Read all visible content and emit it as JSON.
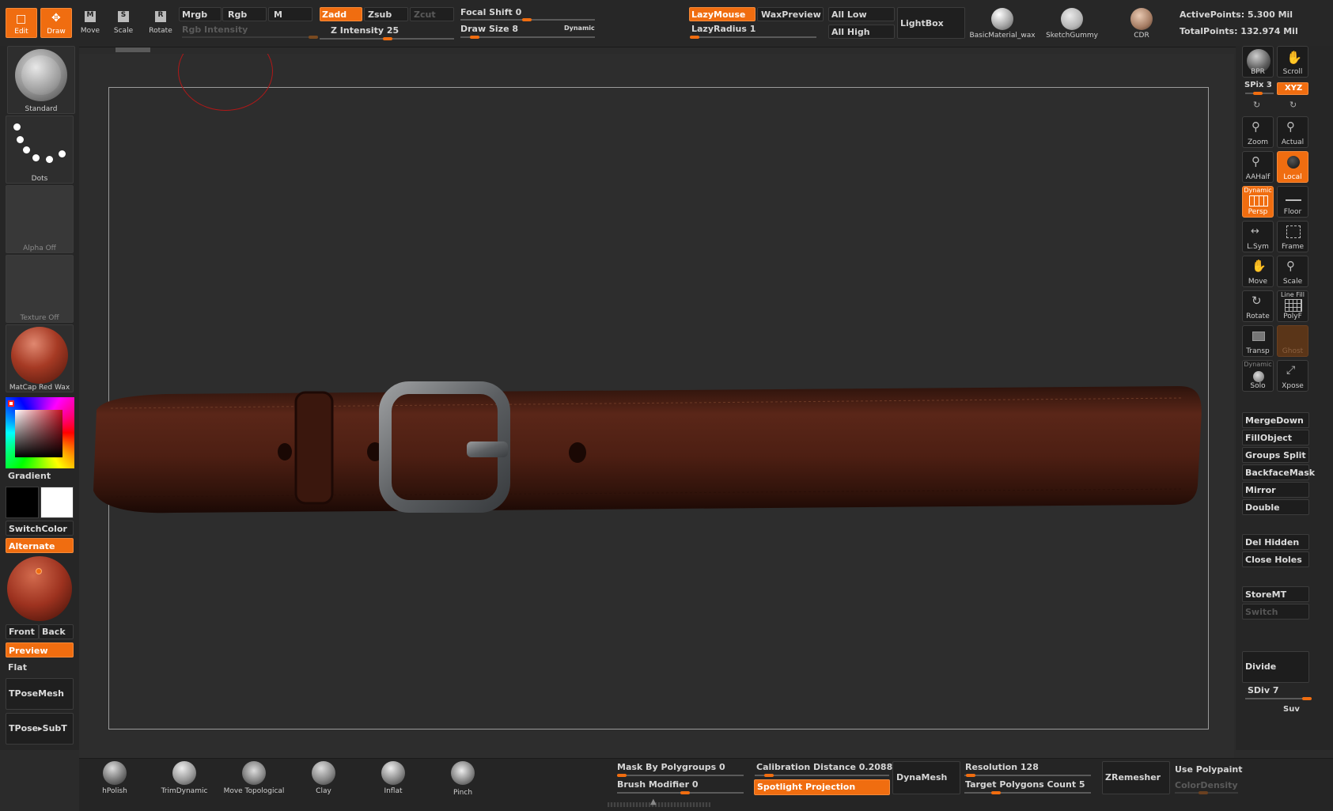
{
  "top": {
    "edit": "Edit",
    "draw": "Draw",
    "move": "Move",
    "scale": "Scale",
    "rotate": "Rotate",
    "mrgb": "Mrgb",
    "rgb": "Rgb",
    "m": "M",
    "rgb_intensity": "Rgb Intensity",
    "zadd": "Zadd",
    "zsub": "Zsub",
    "zcut": "Zcut",
    "z_intensity": "Z Intensity 25",
    "focal_shift": "Focal Shift 0",
    "draw_size": "Draw Size 8",
    "dynamic": "Dynamic",
    "lazymouse": "LazyMouse",
    "waxpreview": "WaxPreview",
    "lazyradius": "LazyRadius 1",
    "all_low": "All Low",
    "all_high": "All High",
    "lightbox": "LightBox",
    "materials": [
      "BasicMaterial_wax",
      "SketchGummy",
      "CDR"
    ],
    "active_points": "ActivePoints: 5.300 Mil",
    "total_points": "TotalPoints: 132.974 Mil"
  },
  "left": {
    "brush": "Standard",
    "stroke": "Dots",
    "alpha": "Alpha Off",
    "texture": "Texture Off",
    "material": "MatCap Red Wax",
    "gradient": "Gradient",
    "switchcolor": "SwitchColor",
    "alternate": "Alternate",
    "front": "Front",
    "back": "Back",
    "preview": "Preview",
    "flat": "Flat",
    "tposemesh": "TPoseMesh",
    "tposesubt": "TPose▸SubT"
  },
  "right": {
    "bpr": "BPR",
    "scroll": "Scroll",
    "spix": "SPix 3",
    "xyz": "XYZ",
    "zoom": "Zoom",
    "actual": "Actual",
    "aahalf": "AAHalf",
    "local": "Local",
    "dynamic_small": "Dynamic",
    "persp": "Persp",
    "floor": "Floor",
    "lsym": "L.Sym",
    "frame": "Frame",
    "move": "Move",
    "scale": "Scale",
    "rotate": "Rotate",
    "line_fill": "Line Fill",
    "polyf": "PolyF",
    "transp": "Transp",
    "ghost": "Ghost",
    "solo": "Solo",
    "xpose": "Xpose",
    "buttons": [
      "MergeDown",
      "FillObject",
      "Groups Split",
      "BackfaceMask",
      "Mirror",
      "Double",
      "Del Hidden",
      "Close Holes",
      "StoreMT",
      "Switch"
    ],
    "divide": "Divide",
    "sdiv": "SDiv 7",
    "suv": "Suv"
  },
  "bottom": {
    "brushes": [
      "hPolish",
      "TrimDynamic",
      "Move Topological",
      "Clay",
      "Inflat",
      "Pinch"
    ],
    "mask_by_polygroups": "Mask By Polygroups 0",
    "brush_modifier": "Brush Modifier 0",
    "calibration": "Calibration Distance 0.20882",
    "spotlight": "Spotlight Projection",
    "dynamesh": "DynaMesh",
    "resolution": "Resolution 128",
    "target_polygons": "Target Polygons Count 5",
    "zremesher": "ZRemesher",
    "use_polypaint": "Use Polypaint",
    "colordensity": "ColorDensity"
  },
  "colors": {
    "accent": "#f06d10",
    "panel": "#1f1f1f",
    "canvas": "#2b2b2b",
    "leather": "#4a1f14"
  }
}
